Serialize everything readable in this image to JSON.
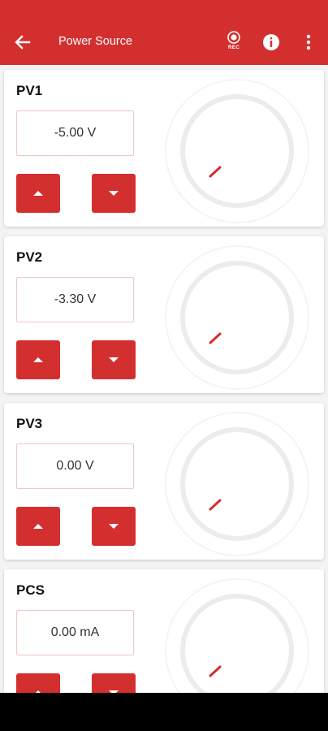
{
  "appbar": {
    "title": "Power Source",
    "rec_label": "REC",
    "back_icon": "arrow-back-icon",
    "record_icon": "record-icon",
    "info_icon": "info-icon",
    "menu_icon": "more-vert-icon",
    "color": "#d32f2f"
  },
  "channels": [
    {
      "name": "PV1",
      "value": "-5.00 V"
    },
    {
      "name": "PV2",
      "value": "-3.30 V"
    },
    {
      "name": "PV3",
      "value": "0.00 V"
    },
    {
      "name": "PCS",
      "value": "0.00 mA"
    }
  ],
  "colors": {
    "accent": "#d32f2f",
    "background": "#f3f3f3",
    "card": "#ffffff"
  }
}
